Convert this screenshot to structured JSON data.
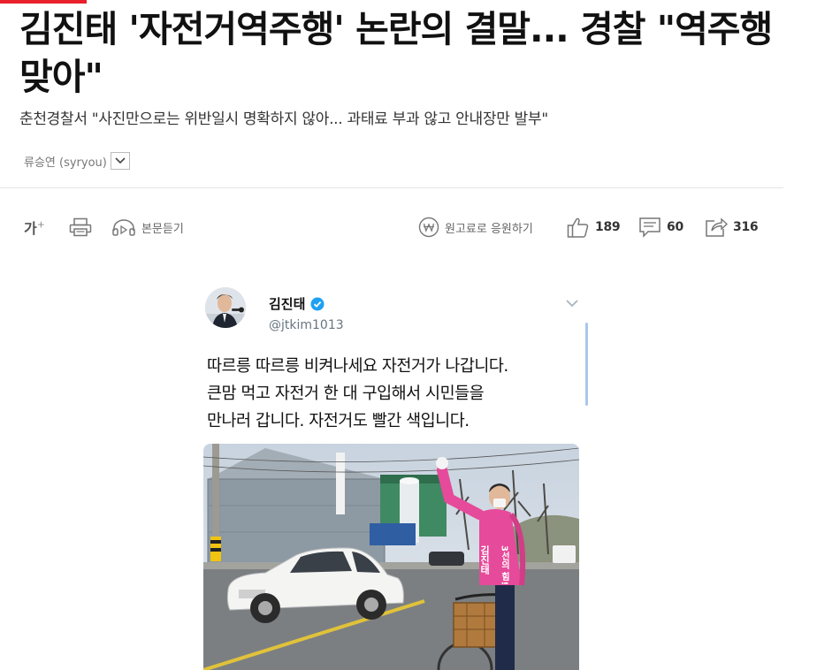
{
  "article": {
    "headline": "김진태 '자전거역주행' 논란의 결말... 경찰 \"역주행 맞아\"",
    "subtitle": "춘천경찰서 \"사진만으로는 위반일시 명확하지 않아... 과태료 부과 않고 안내장만 발부\"",
    "author": "류승연 (syryou)"
  },
  "toolbar": {
    "font_size_label": "가",
    "font_size_plus": "+",
    "listen_label": "본문듣기",
    "donate_label": "원고료로 응원하기",
    "like_count": "189",
    "comment_count": "60",
    "share_count": "316"
  },
  "tweet": {
    "name": "김진태",
    "handle": "@jtkim1013",
    "lines": [
      "따르릉 따르릉 비켜나세요 자전거가 나갑니다.",
      "큰맘 먹고 자전거 한 대 구입해서 시민들을",
      "만나러 갑니다. 자전거도 빨간 색입니다."
    ],
    "vest_text_left": "김진태",
    "vest_text_right": "3선의 힘!"
  },
  "colors": {
    "accent": "#e8202a",
    "verified": "#1da1f2",
    "vest": "#e64a9a"
  }
}
